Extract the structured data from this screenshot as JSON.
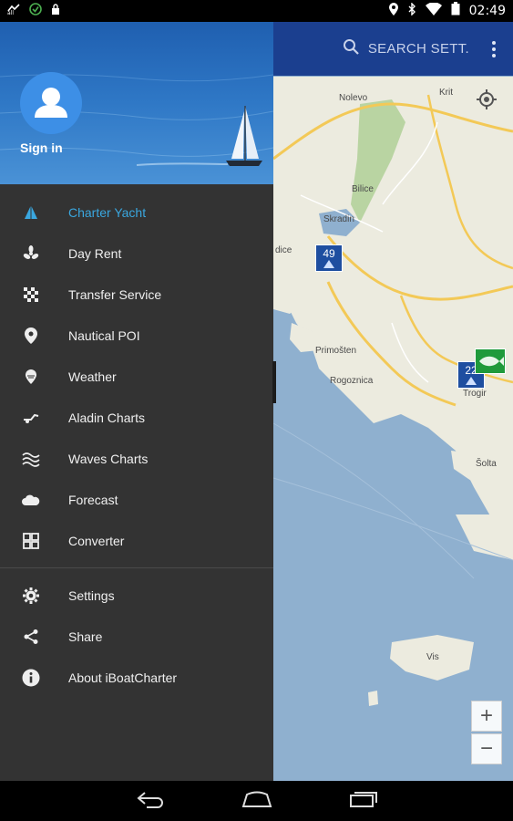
{
  "status_bar": {
    "time": "02:49",
    "left_icons": [
      "notification-icon",
      "sync-icon",
      "lock-icon"
    ],
    "right_icons": [
      "location-icon",
      "bluetooth-icon",
      "wifi-icon",
      "battery-icon"
    ]
  },
  "app_bar": {
    "search_label": "SEARCH SETT."
  },
  "drawer": {
    "sign_in_label": "Sign in",
    "items": [
      {
        "label": "Charter Yacht",
        "icon": "sailboat-icon",
        "active": true
      },
      {
        "label": "Day Rent",
        "icon": "propeller-icon"
      },
      {
        "label": "Transfer Service",
        "icon": "checkered-flag-icon"
      },
      {
        "label": "Nautical POI",
        "icon": "map-pin-icon"
      },
      {
        "label": "Weather",
        "icon": "weather-icon"
      },
      {
        "label": "Aladin Charts",
        "icon": "wind-chart-icon"
      },
      {
        "label": "Waves Charts",
        "icon": "waves-icon"
      },
      {
        "label": "Forecast",
        "icon": "cloud-icon"
      },
      {
        "label": "Converter",
        "icon": "converter-icon"
      }
    ],
    "secondary_items": [
      {
        "label": "Settings",
        "icon": "gear-icon"
      },
      {
        "label": "Share",
        "icon": "share-icon"
      },
      {
        "label": "About iBoatCharter",
        "icon": "info-icon"
      }
    ]
  },
  "map": {
    "places": [
      "Nolevo",
      "Krit",
      "Bilice",
      "Skradin",
      "Primošten",
      "Rogoznica",
      "Šolta",
      "Vis",
      "Trogir",
      "dice"
    ],
    "markers": [
      {
        "count": "49"
      },
      {
        "count": "22"
      }
    ],
    "zoom_in_label": "+",
    "zoom_out_label": "−"
  },
  "nav_bar": {
    "buttons": [
      "back-icon",
      "home-icon",
      "recents-icon"
    ]
  },
  "colors": {
    "app_bar": "#1b3f8f",
    "drawer_bg": "#333333",
    "active_item": "#3aa7df",
    "sea": "#8fb0cf",
    "land": "#ececdf",
    "marker": "#1e4ea0"
  }
}
